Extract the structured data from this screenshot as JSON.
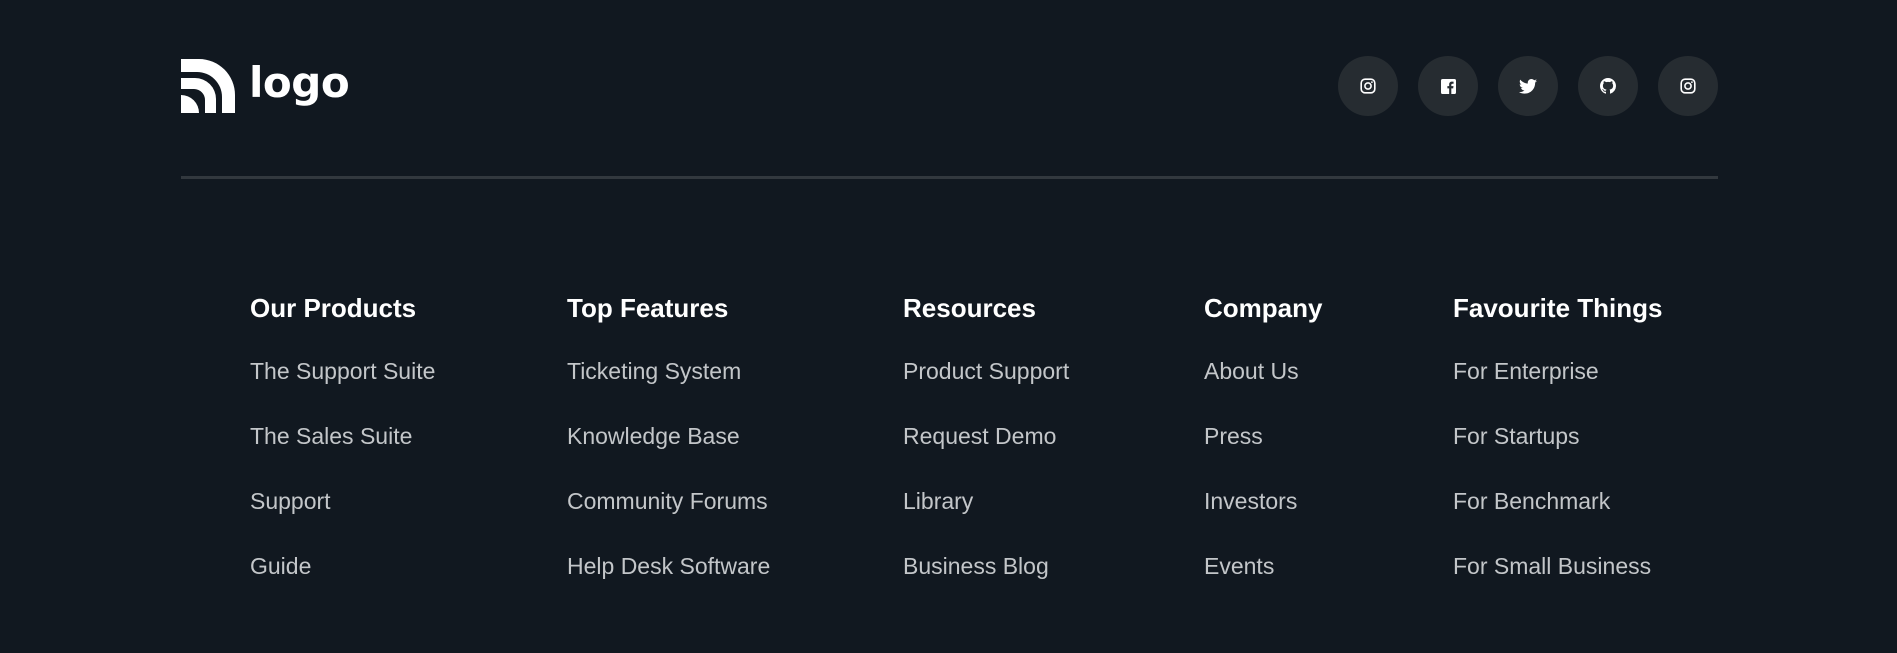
{
  "brand": {
    "logo_text": "logo",
    "icon": "wifi-arcs-logo-icon"
  },
  "socials": [
    {
      "name": "instagram",
      "icon": "instagram-icon"
    },
    {
      "name": "facebook",
      "icon": "facebook-icon"
    },
    {
      "name": "twitter",
      "icon": "twitter-icon"
    },
    {
      "name": "github",
      "icon": "github-icon"
    },
    {
      "name": "instagram",
      "icon": "instagram-icon"
    }
  ],
  "columns": [
    {
      "title": "Our Products",
      "links": [
        "The Support Suite",
        "The Sales Suite",
        "Support",
        "Guide"
      ]
    },
    {
      "title": "Top Features",
      "links": [
        "Ticketing System",
        "Knowledge Base",
        "Community Forums",
        "Help Desk Software"
      ]
    },
    {
      "title": "Resources",
      "links": [
        "Product Support",
        "Request Demo",
        "Library",
        "Business Blog"
      ]
    },
    {
      "title": "Company",
      "links": [
        "About Us",
        "Press",
        "Investors",
        "Events"
      ]
    },
    {
      "title": "Favourite Things",
      "links": [
        "For Enterprise",
        "For Startups",
        "For Benchmark",
        "For Small Business"
      ]
    }
  ],
  "colors": {
    "background": "#111820",
    "social_button": "#262c31",
    "divider": "#32383e",
    "heading": "#ffffff",
    "link": "#c3c6c9"
  }
}
